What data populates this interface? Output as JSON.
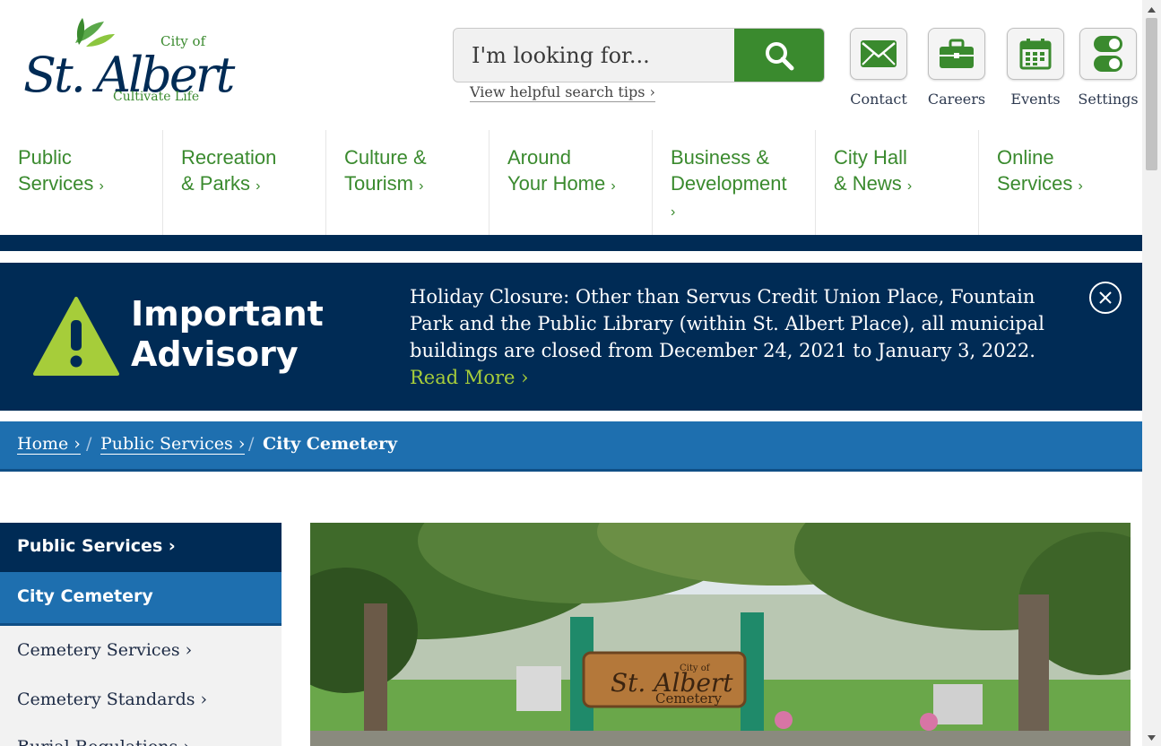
{
  "logo": {
    "city_of": "City of",
    "name": "St. Albert",
    "tagline": "Cultivate Life"
  },
  "search": {
    "placeholder": "I'm looking for...",
    "tips": "View helpful search tips ›"
  },
  "quick_links": [
    {
      "label": "Contact",
      "icon": "envelope-icon"
    },
    {
      "label": "Careers",
      "icon": "briefcase-icon"
    },
    {
      "label": "Events",
      "icon": "calendar-icon"
    },
    {
      "label": "Settings",
      "icon": "toggle-icon"
    }
  ],
  "nav": [
    {
      "line1": "Public",
      "line2": "Services",
      "chev": "›"
    },
    {
      "line1": "Recreation",
      "line2": "& Parks",
      "chev": "›"
    },
    {
      "line1": "Culture &",
      "line2": "Tourism",
      "chev": "›"
    },
    {
      "line1": "Around",
      "line2": "Your Home",
      "chev": "›"
    },
    {
      "line1": "Business &",
      "line2": "Development",
      "chev": "›"
    },
    {
      "line1": "City Hall",
      "line2": "& News",
      "chev": "›"
    },
    {
      "line1": "Online",
      "line2": "Services",
      "chev": "›"
    }
  ],
  "advisory": {
    "title_line1": "Important",
    "title_line2": "Advisory",
    "text": "Holiday Closure: Other than Servus Credit Union Place, Fountain Park and the Public Library (within St. Albert Place), all municipal buildings are closed from December 24, 2021 to January 3, 2022.",
    "read_more": "Read More ›"
  },
  "breadcrumb": {
    "home": "Home ›",
    "public_services": "Public Services ›",
    "separator": "/",
    "current": "City Cemetery"
  },
  "side_nav": {
    "header": "Public Services ›",
    "active": "City Cemetery",
    "links": [
      "Cemetery Services ›",
      "Cemetery Standards ›",
      "Burial Regulations ›"
    ]
  },
  "photo": {
    "sign_city_of": "City of",
    "sign_name": "St. Albert",
    "sign_sub": "Cemetery"
  },
  "colors": {
    "brand_green": "#3a8a2e",
    "navy": "#002b55",
    "blue": "#1e6faf",
    "lime": "#a6cd3a"
  }
}
